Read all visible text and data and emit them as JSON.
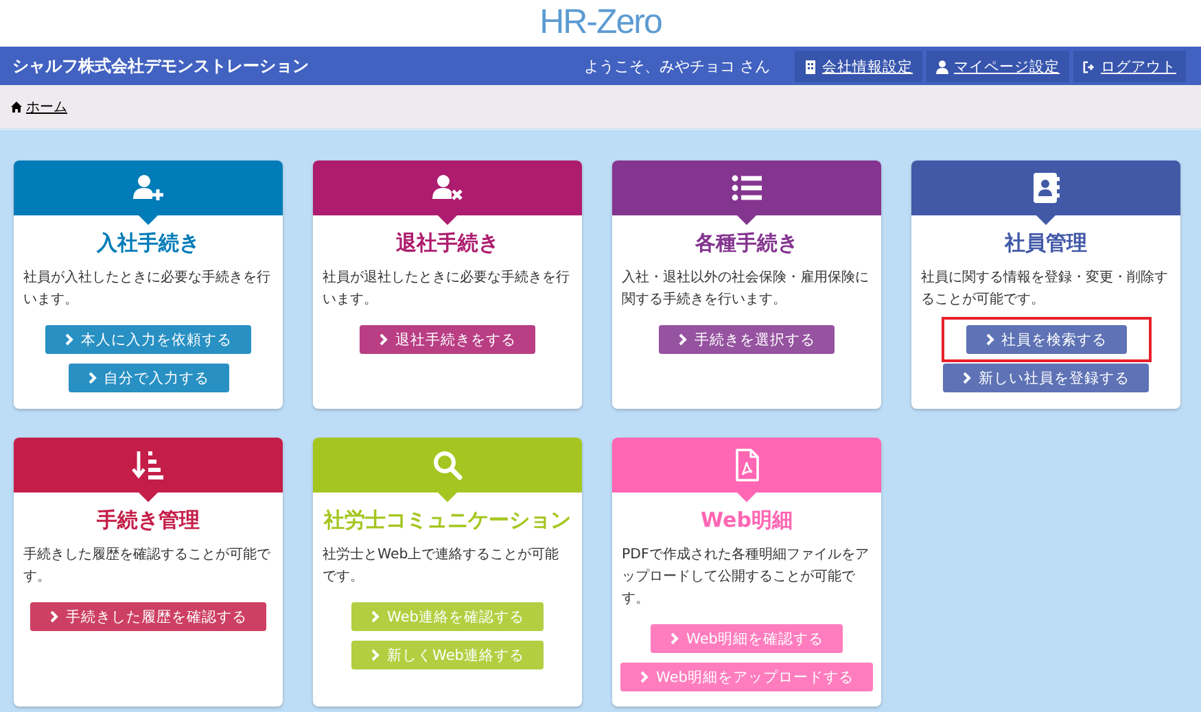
{
  "logo": {
    "text": "HR-Zero"
  },
  "header": {
    "company": "シャルフ株式会社デモンストレーション",
    "welcome": "ようこそ、みやチョコ さん",
    "links": [
      {
        "label": "会社情報設定"
      },
      {
        "label": "マイページ設定"
      },
      {
        "label": "ログアウト"
      }
    ]
  },
  "breadcrumb": [
    {
      "label": "ホーム"
    }
  ],
  "cards": [
    {
      "title": "入社手続き",
      "color": "#027cb8",
      "description": "社員が入社したときに必要な手続きを行います。",
      "buttons": [
        {
          "label": "本人に入力を依頼する",
          "highlighted": false
        },
        {
          "label": "自分で入力する",
          "highlighted": false
        }
      ]
    },
    {
      "title": "退社手続き",
      "color": "#ad1c6e",
      "description": "社員が退社したときに必要な手続きを行います。",
      "buttons": [
        {
          "label": "退社手続きをする",
          "highlighted": false
        }
      ]
    },
    {
      "title": "各種手続き",
      "color": "#84358f",
      "description": "入社・退社以外の社会保険・雇用保険に関する手続きを行います。",
      "buttons": [
        {
          "label": "手続きを選択する",
          "highlighted": false
        }
      ]
    },
    {
      "title": "社員管理",
      "color": "#4259a8",
      "description": "社員に関する情報を登録・変更・削除することが可能です。",
      "buttons": [
        {
          "label": "社員を検索する",
          "highlighted": true
        },
        {
          "label": "新しい社員を登録する",
          "highlighted": false
        }
      ]
    },
    {
      "title": "手続き管理",
      "color": "#c41e48",
      "description": "手続きした履歴を確認することが可能です。",
      "buttons": [
        {
          "label": "手続きした履歴を確認する",
          "highlighted": false
        }
      ]
    },
    {
      "title": "社労士コミュニケーション",
      "color": "#a5c620",
      "description": "社労士とWeb上で連絡することが可能です。",
      "buttons": [
        {
          "label": "Web連絡を確認する",
          "highlighted": false
        },
        {
          "label": "新しくWeb連絡する",
          "highlighted": false
        }
      ]
    },
    {
      "title": "Web明細",
      "color": "#ff66b3",
      "description": "PDFで作成された各種明細ファイルをアップロードして公開することが可能です。",
      "buttons": [
        {
          "label": "Web明細を確認する",
          "highlighted": false
        },
        {
          "label": "Web明細をアップロードする",
          "highlighted": false
        }
      ]
    }
  ]
}
